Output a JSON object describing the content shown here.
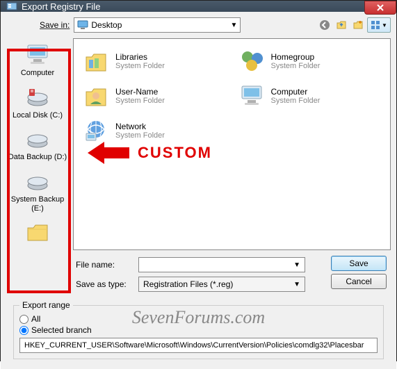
{
  "window": {
    "title": "Export Registry File"
  },
  "savein": {
    "label": "Save in:",
    "value": "Desktop"
  },
  "toolbar_icons": {
    "back": "back-icon",
    "up": "up-icon",
    "new_folder": "new-folder-icon",
    "view": "view-icon"
  },
  "places": [
    {
      "label": "Computer",
      "icon": "computer"
    },
    {
      "label": "Local Disk (C:)",
      "icon": "disk"
    },
    {
      "label": "Data Backup (D:)",
      "icon": "disk"
    },
    {
      "label": "System Backup (E:)",
      "icon": "disk"
    },
    {
      "label": "",
      "icon": "folder"
    }
  ],
  "annotation": {
    "text": "CUSTOM"
  },
  "items": [
    {
      "name": "Libraries",
      "sub": "System Folder",
      "icon": "libraries"
    },
    {
      "name": "Homegroup",
      "sub": "System Folder",
      "icon": "homegroup"
    },
    {
      "name": "User-Name",
      "sub": "System Folder",
      "icon": "user"
    },
    {
      "name": "Computer",
      "sub": "System Folder",
      "icon": "computer"
    },
    {
      "name": "Network",
      "sub": "System Folder",
      "icon": "network"
    }
  ],
  "filename": {
    "label": "File name:",
    "value": ""
  },
  "savetype": {
    "label": "Save as type:",
    "value": "Registration Files (*.reg)"
  },
  "buttons": {
    "save": "Save",
    "cancel": "Cancel"
  },
  "export_range": {
    "legend": "Export range",
    "all": "All",
    "selected": "Selected branch",
    "branch_path": "HKEY_CURRENT_USER\\Software\\Microsoft\\Windows\\CurrentVersion\\Policies\\comdlg32\\Placesbar"
  },
  "watermark": "SevenForums.com"
}
